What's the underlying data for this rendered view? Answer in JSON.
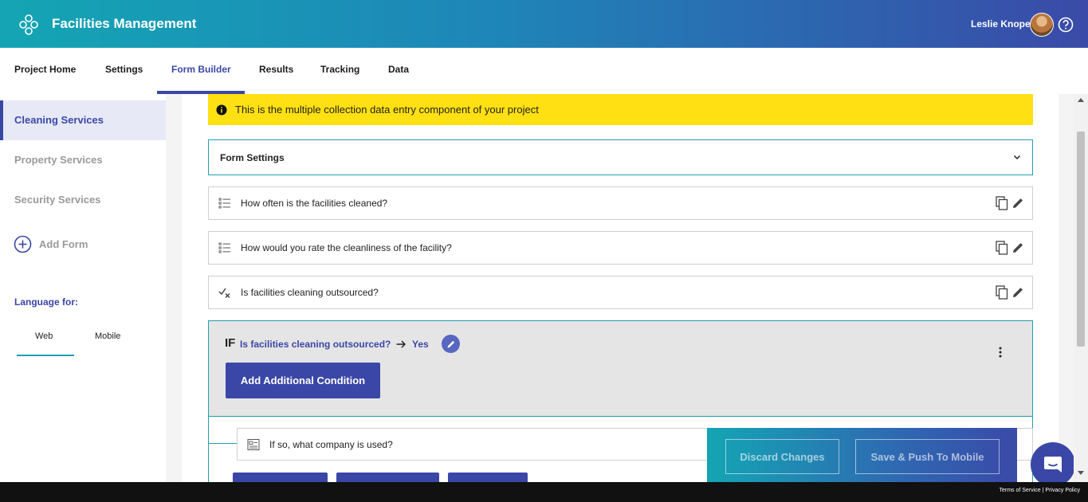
{
  "header": {
    "app_title": "Facilities Management",
    "user_name": "Leslie Knope",
    "brand_gradient": [
      "#14a5b4",
      "#3a4aa8"
    ]
  },
  "nav": {
    "tabs": [
      {
        "label": "Project Home"
      },
      {
        "label": "Settings"
      },
      {
        "label": "Form Builder",
        "active": true
      },
      {
        "label": "Results"
      },
      {
        "label": "Tracking"
      },
      {
        "label": "Data"
      }
    ]
  },
  "sidebar": {
    "items": [
      {
        "label": "Cleaning Services",
        "active": true
      },
      {
        "label": "Property Services"
      },
      {
        "label": "Security Services"
      }
    ],
    "add_form_label": "Add Form",
    "language_label": "Language for:",
    "language_tabs": [
      {
        "label": "Web",
        "active": true
      },
      {
        "label": "Mobile"
      }
    ]
  },
  "main": {
    "banner_text": "This is the multiple collection data entry component of your project",
    "form_settings_label": "Form Settings",
    "questions": [
      {
        "text": "How often is the facilities cleaned?",
        "icon": "list-icon"
      },
      {
        "text": "How would you rate the cleanliness of the facility?",
        "icon": "list-icon"
      },
      {
        "text": "Is facilities cleaning outsourced?",
        "icon": "yes-no-icon"
      }
    ],
    "condition": {
      "if_label": "IF",
      "question": "Is facilities cleaning outsourced?",
      "value": "Yes",
      "add_condition_label": "Add Additional Condition"
    },
    "nested_question": {
      "text": "If so, what company is used?",
      "icon": "text-field-icon"
    }
  },
  "save_panel": {
    "discard_label": "Discard Changes",
    "save_label": "Save & Push To Mobile"
  },
  "footer": {
    "terms": "Terms of Service",
    "privacy": "Privacy Policy"
  },
  "colors": {
    "accent": "#3b47a6",
    "teal": "#1ea0ae",
    "banner": "#ffe012"
  }
}
